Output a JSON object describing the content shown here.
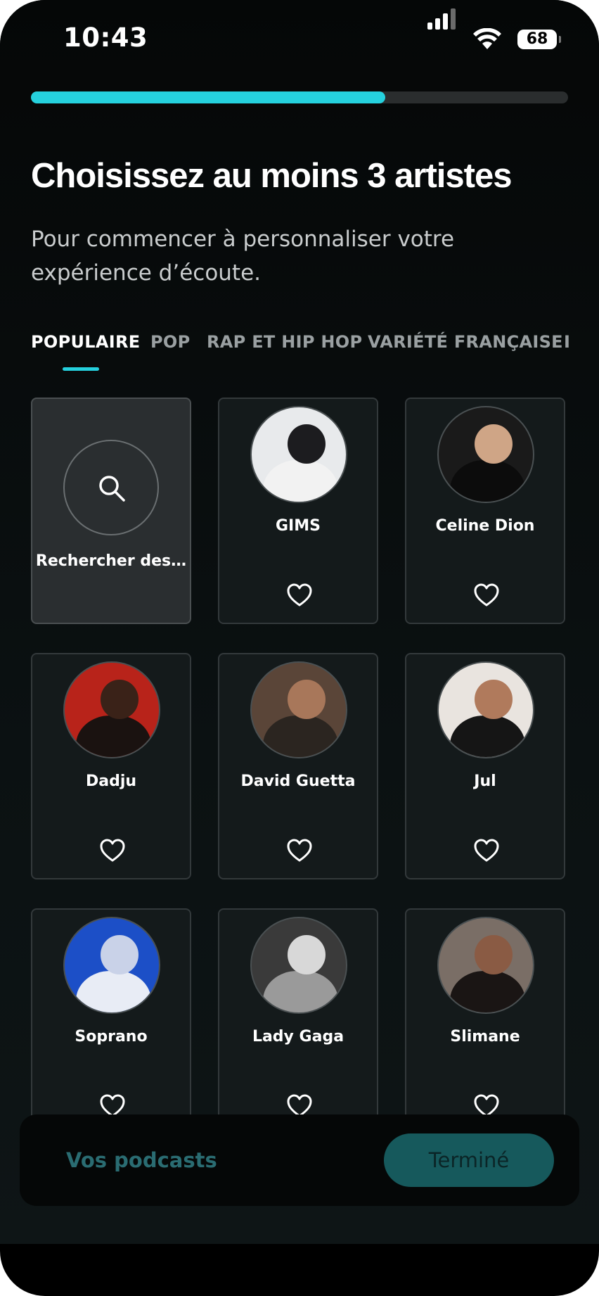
{
  "status_bar": {
    "time": "10:43",
    "battery": "68"
  },
  "progress": {
    "fraction": 0.66,
    "color": "#25d1de"
  },
  "header": {
    "title": "Choisissez au moins 3 artistes",
    "subtitle": "Pour commencer à personnaliser votre expérience d’écoute."
  },
  "tabs": [
    {
      "label": "POPULAIRE",
      "active": true
    },
    {
      "label": "POP",
      "active": false
    },
    {
      "label": "RAP ET HIP HOP",
      "active": false
    },
    {
      "label": "VARIÉTÉ FRANÇAISE",
      "active": false
    },
    {
      "label": "I",
      "active": false
    }
  ],
  "search_card": {
    "label": "Rechercher des…",
    "icon": "search-icon"
  },
  "artists": [
    {
      "name": "GIMS",
      "icon": "heart-outline-icon",
      "palette": [
        "#e8eaec",
        "#1c1c1f",
        "#f2f2f2"
      ]
    },
    {
      "name": "Celine Dion",
      "icon": "heart-outline-icon",
      "palette": [
        "#1a1a1a",
        "#cfa586",
        "#0c0c0c"
      ]
    },
    {
      "name": "Dadju",
      "icon": "heart-outline-icon",
      "palette": [
        "#b8231a",
        "#3a2218",
        "#1a1210"
      ]
    },
    {
      "name": "David Guetta",
      "icon": "heart-outline-icon",
      "palette": [
        "#5a4538",
        "#a8775a",
        "#2b2520"
      ]
    },
    {
      "name": "Jul",
      "icon": "heart-outline-icon",
      "palette": [
        "#e9e4df",
        "#b07a5c",
        "#151515"
      ]
    },
    {
      "name": "Soprano",
      "icon": "heart-outline-icon",
      "palette": [
        "#1c4fc7",
        "#c9d2e8",
        "#e8ecf5"
      ]
    },
    {
      "name": "Lady Gaga",
      "icon": "heart-outline-icon",
      "palette": [
        "#3a3a3a",
        "#d8d8d8",
        "#9a9a9a"
      ]
    },
    {
      "name": "Slimane",
      "icon": "heart-outline-icon",
      "palette": [
        "#7a6e66",
        "#8a5b44",
        "#1a1514"
      ]
    }
  ],
  "bottom_bar": {
    "podcasts_label": "Vos podcasts",
    "done_label": "Terminé"
  }
}
